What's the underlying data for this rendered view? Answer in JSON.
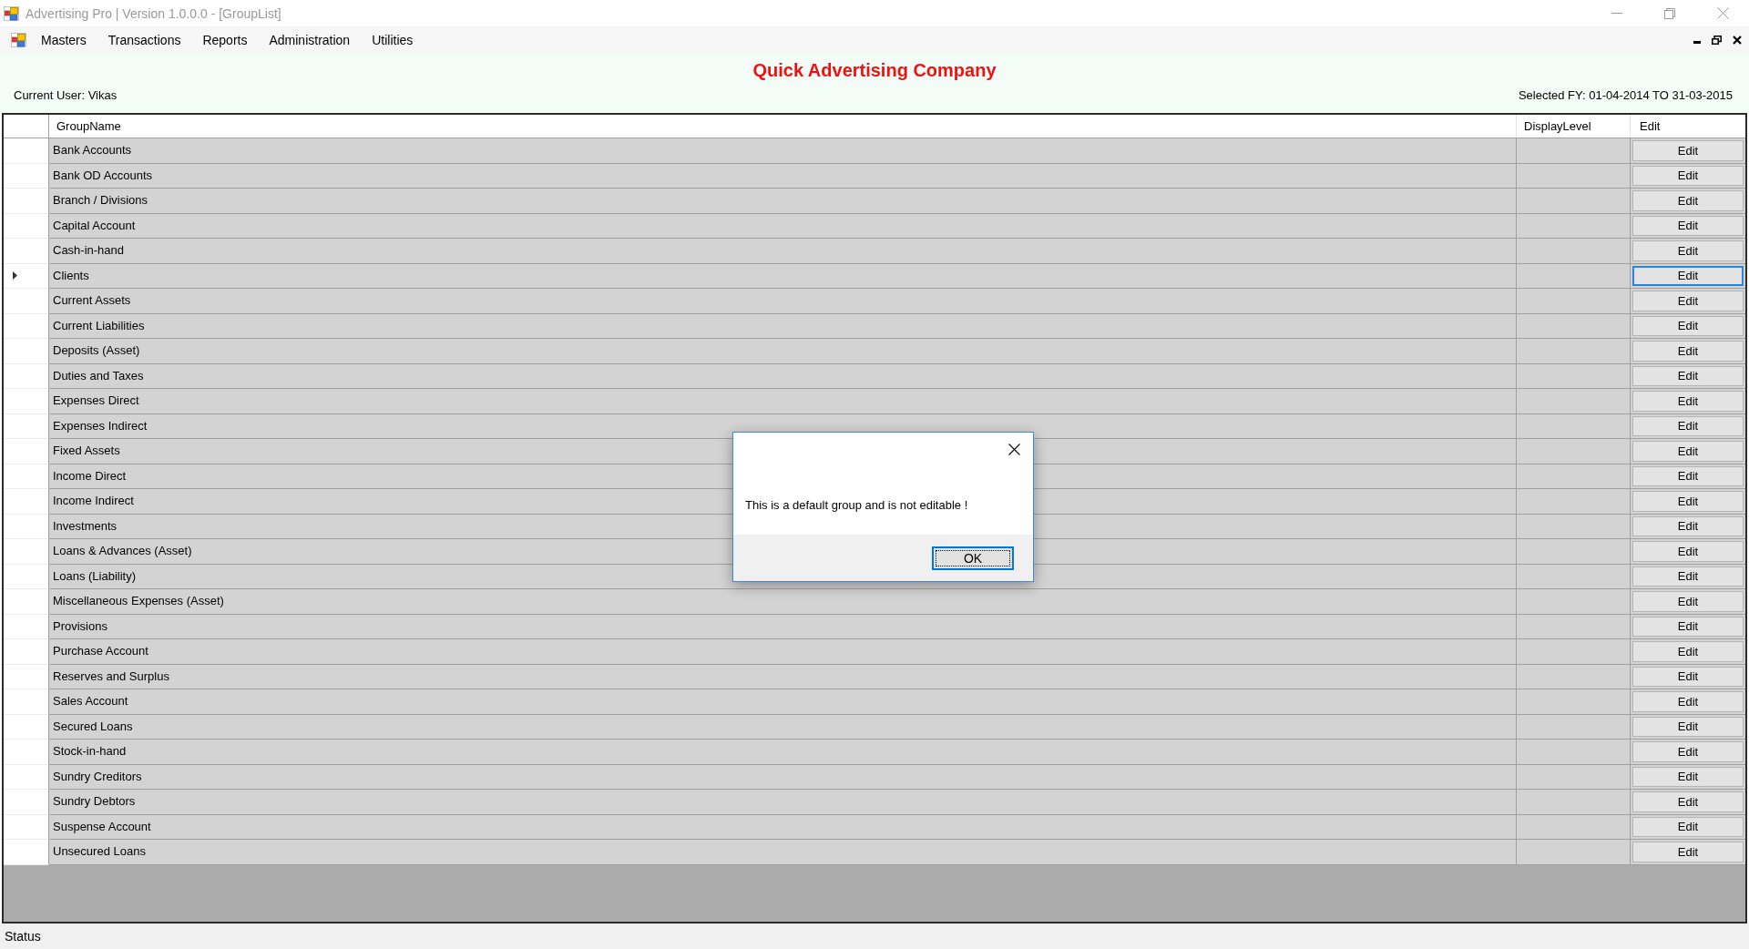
{
  "window": {
    "title": "Advertising Pro | Version 1.0.0.0 - [GroupList]"
  },
  "menu": {
    "items": [
      "Masters",
      "Transactions",
      "Reports",
      "Administration",
      "Utilities"
    ]
  },
  "header": {
    "company_name": "Quick Advertising Company",
    "current_user": "Current User: Vikas",
    "financial_year": "Selected FY: 01-04-2014 TO 31-03-2015"
  },
  "table": {
    "columns": [
      "GroupName",
      "DisplayLevel",
      "Edit"
    ],
    "rows": [
      {
        "group_name": "Bank Accounts",
        "edit": "Edit",
        "selected": false
      },
      {
        "group_name": "Bank OD Accounts",
        "edit": "Edit",
        "selected": false
      },
      {
        "group_name": "Branch / Divisions",
        "edit": "Edit",
        "selected": false
      },
      {
        "group_name": "Capital Account",
        "edit": "Edit",
        "selected": false
      },
      {
        "group_name": "Cash-in-hand",
        "edit": "Edit",
        "selected": false
      },
      {
        "group_name": "Clients",
        "edit": "Edit",
        "selected": true
      },
      {
        "group_name": "Current Assets",
        "edit": "Edit",
        "selected": false
      },
      {
        "group_name": "Current Liabilities",
        "edit": "Edit",
        "selected": false
      },
      {
        "group_name": "Deposits (Asset)",
        "edit": "Edit",
        "selected": false
      },
      {
        "group_name": "Duties and Taxes",
        "edit": "Edit",
        "selected": false
      },
      {
        "group_name": "Expenses Direct",
        "edit": "Edit",
        "selected": false
      },
      {
        "group_name": "Expenses Indirect",
        "edit": "Edit",
        "selected": false
      },
      {
        "group_name": "Fixed Assets",
        "edit": "Edit",
        "selected": false
      },
      {
        "group_name": "Income Direct",
        "edit": "Edit",
        "selected": false
      },
      {
        "group_name": "Income Indirect",
        "edit": "Edit",
        "selected": false
      },
      {
        "group_name": "Investments",
        "edit": "Edit",
        "selected": false
      },
      {
        "group_name": "Loans & Advances (Asset)",
        "edit": "Edit",
        "selected": false
      },
      {
        "group_name": "Loans (Liability)",
        "edit": "Edit",
        "selected": false
      },
      {
        "group_name": "Miscellaneous Expenses (Asset)",
        "edit": "Edit",
        "selected": false
      },
      {
        "group_name": "Provisions",
        "edit": "Edit",
        "selected": false
      },
      {
        "group_name": "Purchase Account",
        "edit": "Edit",
        "selected": false
      },
      {
        "group_name": "Reserves and Surplus",
        "edit": "Edit",
        "selected": false
      },
      {
        "group_name": "Sales Account",
        "edit": "Edit",
        "selected": false
      },
      {
        "group_name": "Secured Loans",
        "edit": "Edit",
        "selected": false
      },
      {
        "group_name": "Stock-in-hand",
        "edit": "Edit",
        "selected": false
      },
      {
        "group_name": "Sundry Creditors",
        "edit": "Edit",
        "selected": false
      },
      {
        "group_name": "Sundry Debtors",
        "edit": "Edit",
        "selected": false
      },
      {
        "group_name": "Suspense Account",
        "edit": "Edit",
        "selected": false
      },
      {
        "group_name": "Unsecured Loans",
        "edit": "Edit",
        "selected": false
      }
    ]
  },
  "dialog": {
    "message": "This is a default group and is not editable !",
    "button": "OK"
  },
  "status_bar": {
    "text": "Status"
  }
}
